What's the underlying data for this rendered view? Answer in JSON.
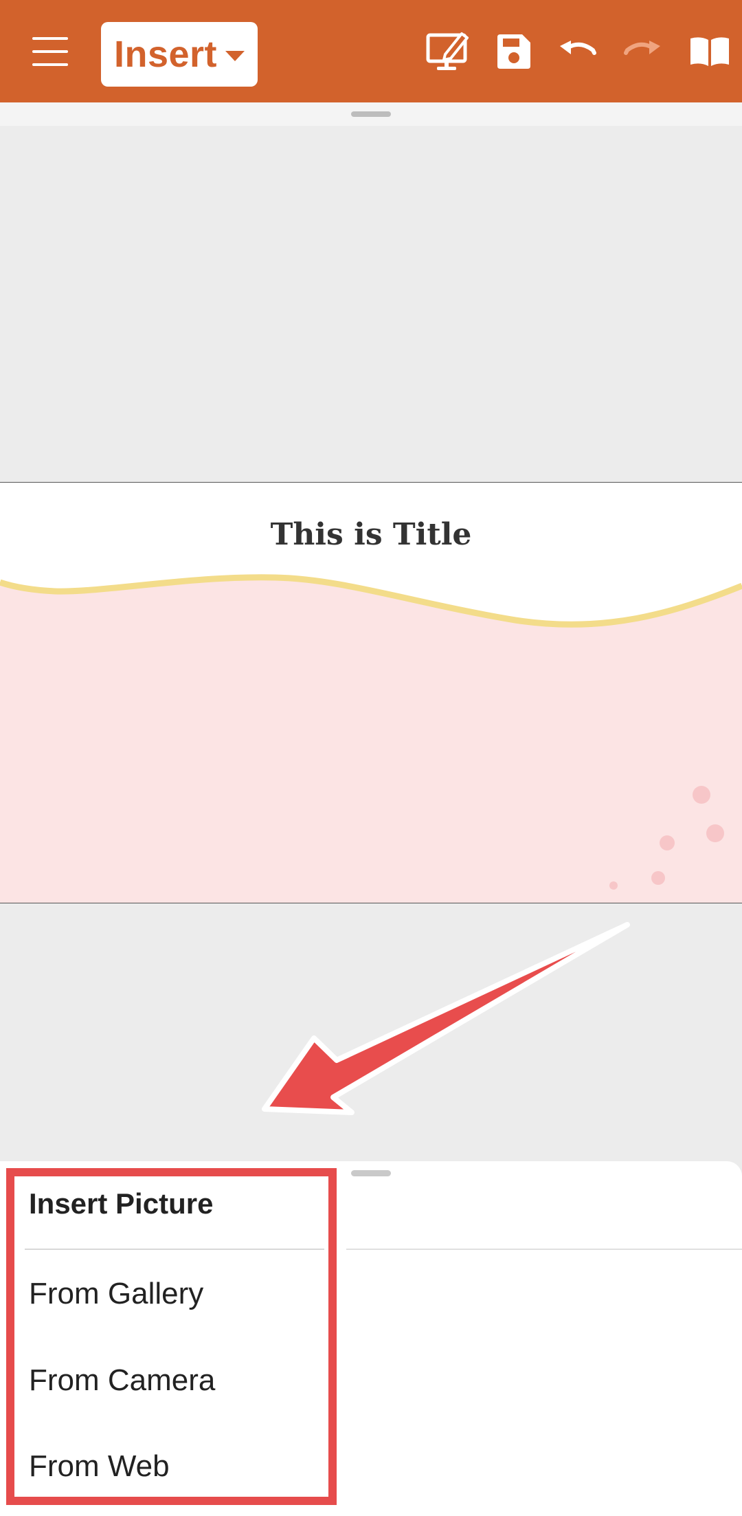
{
  "toolbar": {
    "menu_icon": "hamburger-menu-icon",
    "insert_label": "Insert",
    "insert_caret_icon": "caret-down-icon",
    "actions": [
      "present-icon",
      "save-icon",
      "undo-icon",
      "redo-icon",
      "read-mode-icon"
    ],
    "background_color": "#d2622c"
  },
  "slide": {
    "title": "This is Title",
    "background_color": "#fce4e4",
    "wave_color": "#f3dc8a"
  },
  "insert_picture_menu": {
    "title": "Insert Picture",
    "items": [
      "From Gallery",
      "From Camera",
      "From Web"
    ],
    "highlight_color": "#e64c4c"
  }
}
